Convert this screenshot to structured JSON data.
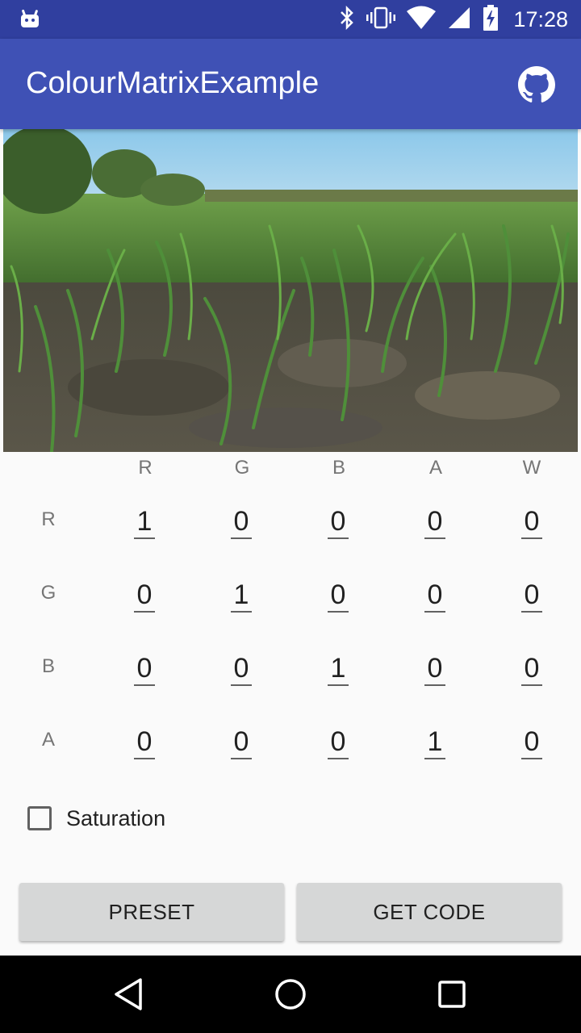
{
  "status_bar": {
    "time": "17:28",
    "icons": [
      "android-icon",
      "bluetooth-icon",
      "vibrate-icon",
      "wifi-icon",
      "signal-icon",
      "battery-charging-icon"
    ]
  },
  "app_bar": {
    "title": "ColourMatrixExample",
    "action_icon": "github-icon"
  },
  "matrix": {
    "column_headers": [
      "R",
      "G",
      "B",
      "A",
      "W"
    ],
    "rows": [
      {
        "label": "R",
        "values": [
          "1",
          "0",
          "0",
          "0",
          "0"
        ]
      },
      {
        "label": "G",
        "values": [
          "0",
          "1",
          "0",
          "0",
          "0"
        ]
      },
      {
        "label": "B",
        "values": [
          "0",
          "0",
          "1",
          "0",
          "0"
        ]
      },
      {
        "label": "A",
        "values": [
          "0",
          "0",
          "0",
          "1",
          "0"
        ]
      }
    ]
  },
  "saturation": {
    "label": "Saturation",
    "checked": false
  },
  "buttons": {
    "preset": "PRESET",
    "get_code": "GET CODE"
  },
  "nav_bar": {
    "icons": [
      "back-icon",
      "home-icon",
      "recents-icon"
    ]
  },
  "colors": {
    "status_bar": "#303f9f",
    "app_bar": "#3f51b5",
    "background": "#fafafa",
    "button": "#d6d7d7"
  }
}
